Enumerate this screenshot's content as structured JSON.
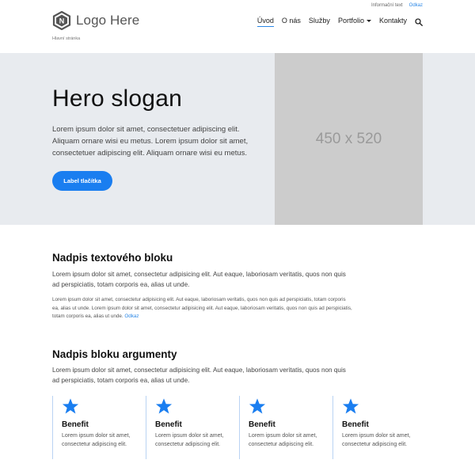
{
  "topbar": {
    "info_text": "Informační text",
    "link_text": "Odkaz"
  },
  "logo": {
    "text": "Logo Here",
    "icon": "hexagon-n-logo"
  },
  "breadcrumb": "Hlavní stránka",
  "nav": {
    "items": [
      {
        "label": "Úvod",
        "active": true
      },
      {
        "label": "O nás"
      },
      {
        "label": "Služby"
      },
      {
        "label": "Portfolio",
        "has_dropdown": true
      },
      {
        "label": "Kontakty"
      }
    ],
    "search_icon": "search-icon"
  },
  "hero": {
    "title": "Hero slogan",
    "text": "Lorem ipsum dolor sit amet, consectetuer adipiscing elit. Aliquam ornare wisi eu metus. Lorem ipsum dolor sit amet, consectetuer adipiscing elit. Aliquam ornare wisi eu metus.",
    "button_label": "Label tlačítka",
    "image_placeholder": "450 x 520"
  },
  "text_block": {
    "title": "Nadpis textového bloku",
    "lead": "Lorem ipsum dolor sit amet, consectetur adipisicing elit. Aut eaque, laboriosam veritatis, quos non quis ad perspiciatis, totam corporis ea, alias ut unde.",
    "body": "Lorem ipsum dolor sit amet, consectetur adipisicing elit. Aut eaque, laboriosam veritatis, quos non quis ad perspiciatis, totam corporis ea, alias ut unde. Lorem ipsum dolor sit amet, consectetur adipisicing elit. Aut eaque, laboriosam veritatis, quos non quis ad perspiciatis, totam corporis ea, alias ut unde.",
    "link_text": "Odkaz"
  },
  "arguments": {
    "title": "Nadpis bloku argumenty",
    "lead": "Lorem ipsum dolor sit amet, consectetur adipisicing elit. Aut eaque, laboriosam veritatis, quos non quis ad perspiciatis, totam corporis ea, alias ut unde.",
    "items": [
      {
        "title": "Benefit",
        "text": "Lorem ipsum dolor sit amet, consectetur adipiscing elit.",
        "icon": "star-icon"
      },
      {
        "title": "Benefit",
        "text": "Lorem ipsum dolor sit amet, consectetur adipiscing elit.",
        "icon": "star-icon"
      },
      {
        "title": "Benefit",
        "text": "Lorem ipsum dolor sit amet, consectetur adipiscing elit.",
        "icon": "star-icon"
      },
      {
        "title": "Benefit",
        "text": "Lorem ipsum dolor sit amet, consectetur adipiscing elit.",
        "icon": "star-icon"
      }
    ]
  },
  "colors": {
    "accent": "#1a7ef0",
    "hero_bg": "#e8ebef",
    "placeholder_bg": "#cccccc"
  }
}
